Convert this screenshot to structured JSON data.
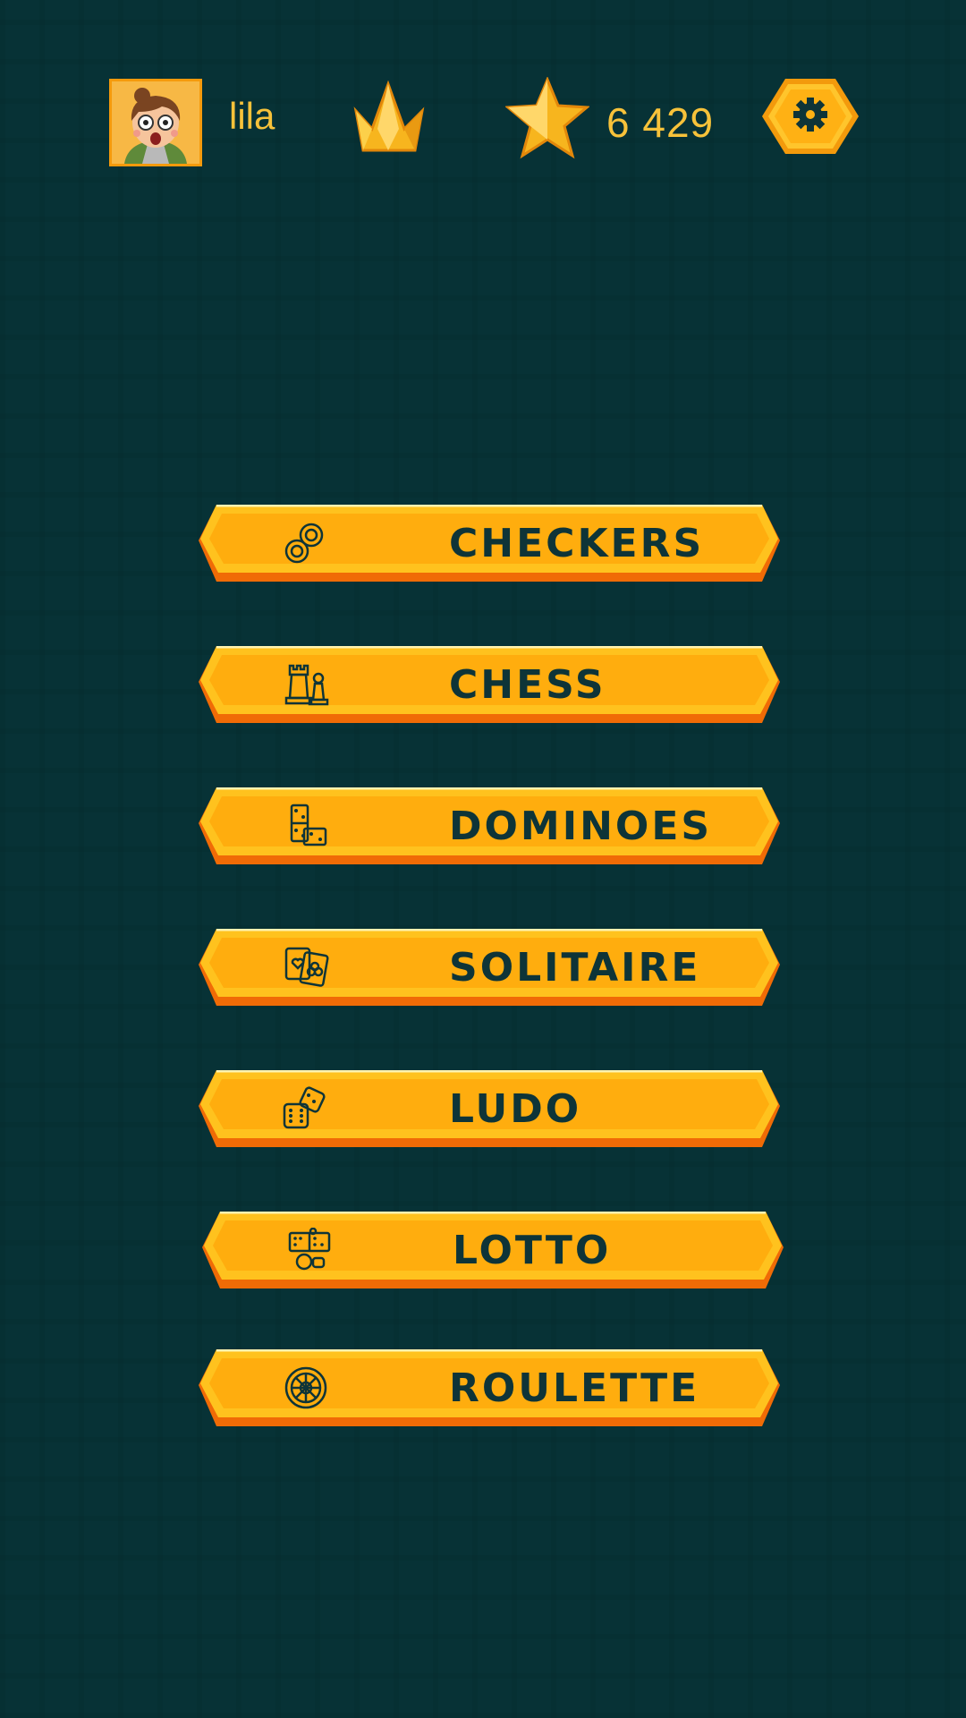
{
  "player": {
    "name": "lila",
    "avatar_icon": "girl-avatar-icon",
    "rank_icon": "crown-icon",
    "stars_icon": "star-icon",
    "stars": "6 429",
    "settings_icon": "gear-icon"
  },
  "colors": {
    "background": "#073236",
    "accent": "#F7C23A",
    "button": "#FFAE10",
    "button_text": "#0E3438"
  },
  "games": [
    {
      "label": "CHECKERS",
      "icon": "checkers-icon"
    },
    {
      "label": "CHESS",
      "icon": "chess-icon"
    },
    {
      "label": "DOMINOES",
      "icon": "dominoes-icon"
    },
    {
      "label": "SOLITAIRE",
      "icon": "cards-icon"
    },
    {
      "label": "LUDO",
      "icon": "dice-icon"
    },
    {
      "label": "LOTTO",
      "icon": "lotto-icon"
    },
    {
      "label": "ROULETTE",
      "icon": "roulette-icon"
    }
  ]
}
